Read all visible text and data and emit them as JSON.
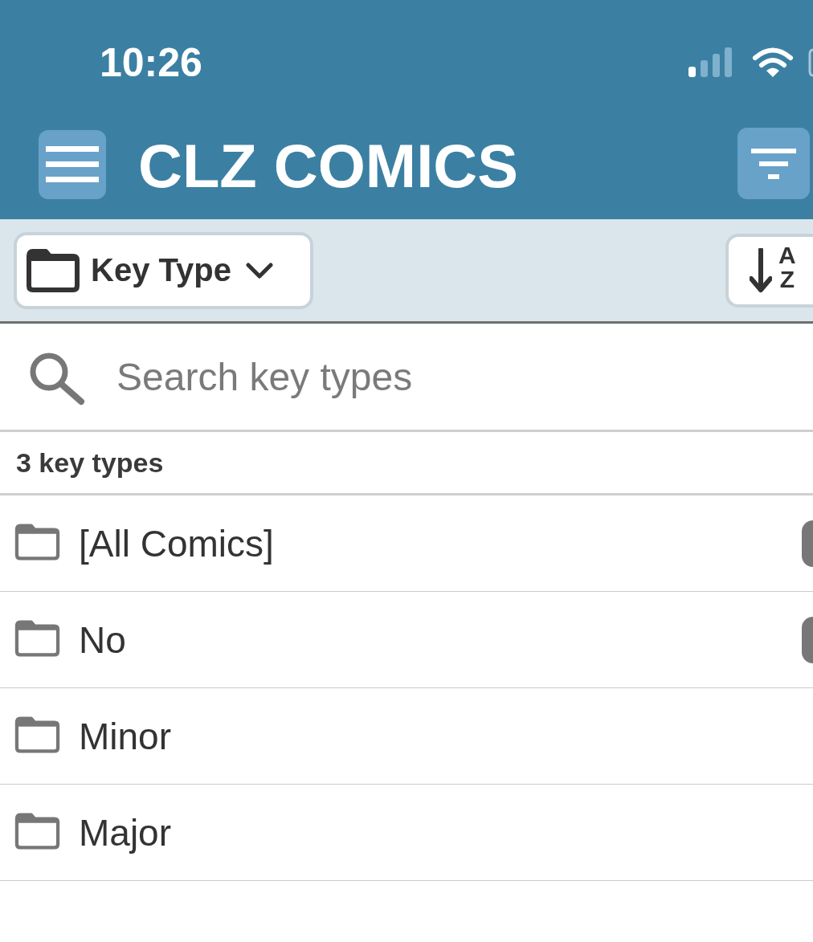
{
  "status_bar": {
    "time": "10:26"
  },
  "header": {
    "title": "CLZ COMICS"
  },
  "toolbar": {
    "group_by": {
      "label": "Key Type"
    },
    "sort_button": {
      "letters": [
        "A",
        "Z"
      ]
    }
  },
  "search": {
    "placeholder": "Search key types"
  },
  "list": {
    "count": "3 key types",
    "items": [
      {
        "label": "[All Comics]",
        "badge": true
      },
      {
        "label": "No",
        "badge": true
      },
      {
        "label": "Minor",
        "badge": false
      },
      {
        "label": "Major",
        "badge": false
      }
    ]
  }
}
